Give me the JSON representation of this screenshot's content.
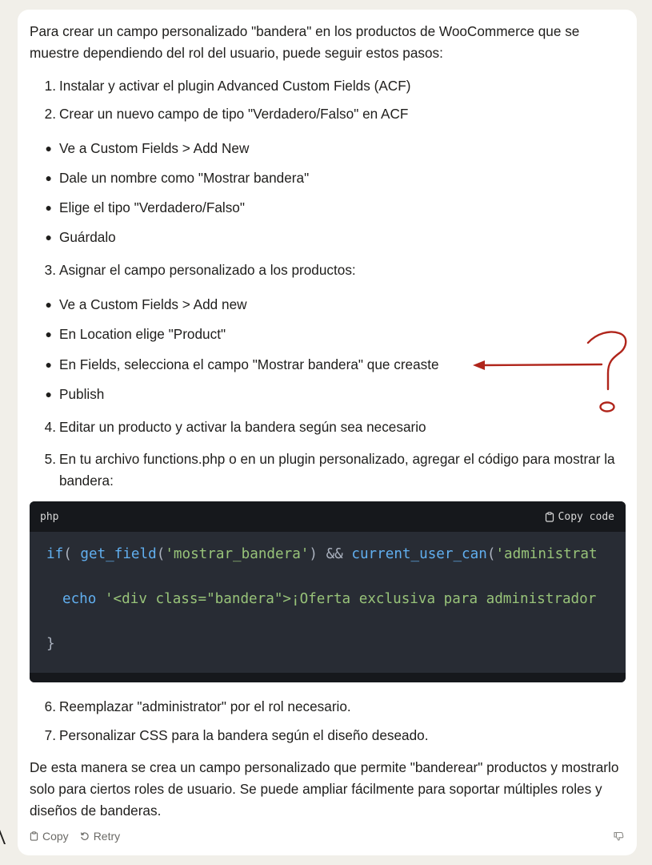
{
  "intro": "Para crear un campo personalizado \"bandera\" en los productos de WooCommerce que se muestre dependiendo del rol del usuario, puede seguir estos pasos:",
  "steps": [
    {
      "n": "1.",
      "text": "Instalar y activar el plugin Advanced Custom Fields (ACF)"
    },
    {
      "n": "2.",
      "text": "Crear un nuevo campo de tipo \"Verdadero/Falso\" en ACF"
    },
    {
      "n": "3.",
      "text": "Asignar el campo personalizado a los productos:"
    },
    {
      "n": "4.",
      "text": "Editar un producto y activar la bandera según sea necesario"
    },
    {
      "n": "5.",
      "text": "En tu archivo functions.php o en un plugin personalizado, agregar el código para mostrar la bandera:"
    },
    {
      "n": "6.",
      "text": "Reemplazar \"administrator\" por el rol necesario."
    },
    {
      "n": "7.",
      "text": "Personalizar CSS para la bandera según el diseño deseado."
    }
  ],
  "bullets_a": [
    "Ve a Custom Fields > Add New",
    "Dale un nombre como \"Mostrar bandera\"",
    "Elige el tipo \"Verdadero/Falso\"",
    "Guárdalo"
  ],
  "bullets_b": [
    "Ve a Custom Fields > Add new",
    "En Location elige \"Product\"",
    "En Fields, selecciona el campo \"Mostrar bandera\" que creaste",
    "Publish"
  ],
  "code": {
    "lang": "php",
    "copy_label": "Copy code",
    "line1": {
      "kw": "if",
      "p1": "( ",
      "fn1": "get_field",
      "p2": "(",
      "s1": "'mostrar_bandera'",
      "p3": ") && ",
      "fn2": "current_user_can",
      "p4": "(",
      "s2": "'administrat"
    },
    "line2": {
      "kw": "echo",
      "p1": " ",
      "s1": "'<div class=\"bandera\">¡Oferta exclusiva para administrador"
    },
    "line3": "}"
  },
  "outro": "De esta manera se crea un campo personalizado que permite \"banderear\" productos y mostrarlo solo para ciertos roles de usuario. Se puede ampliar fácilmente para soportar múltiples roles y diseños de banderas.",
  "actions": {
    "copy": "Copy",
    "retry": "Retry"
  },
  "colors": {
    "annotation": "#b0251b",
    "code_bg": "#282c34",
    "code_header": "#16181c"
  }
}
